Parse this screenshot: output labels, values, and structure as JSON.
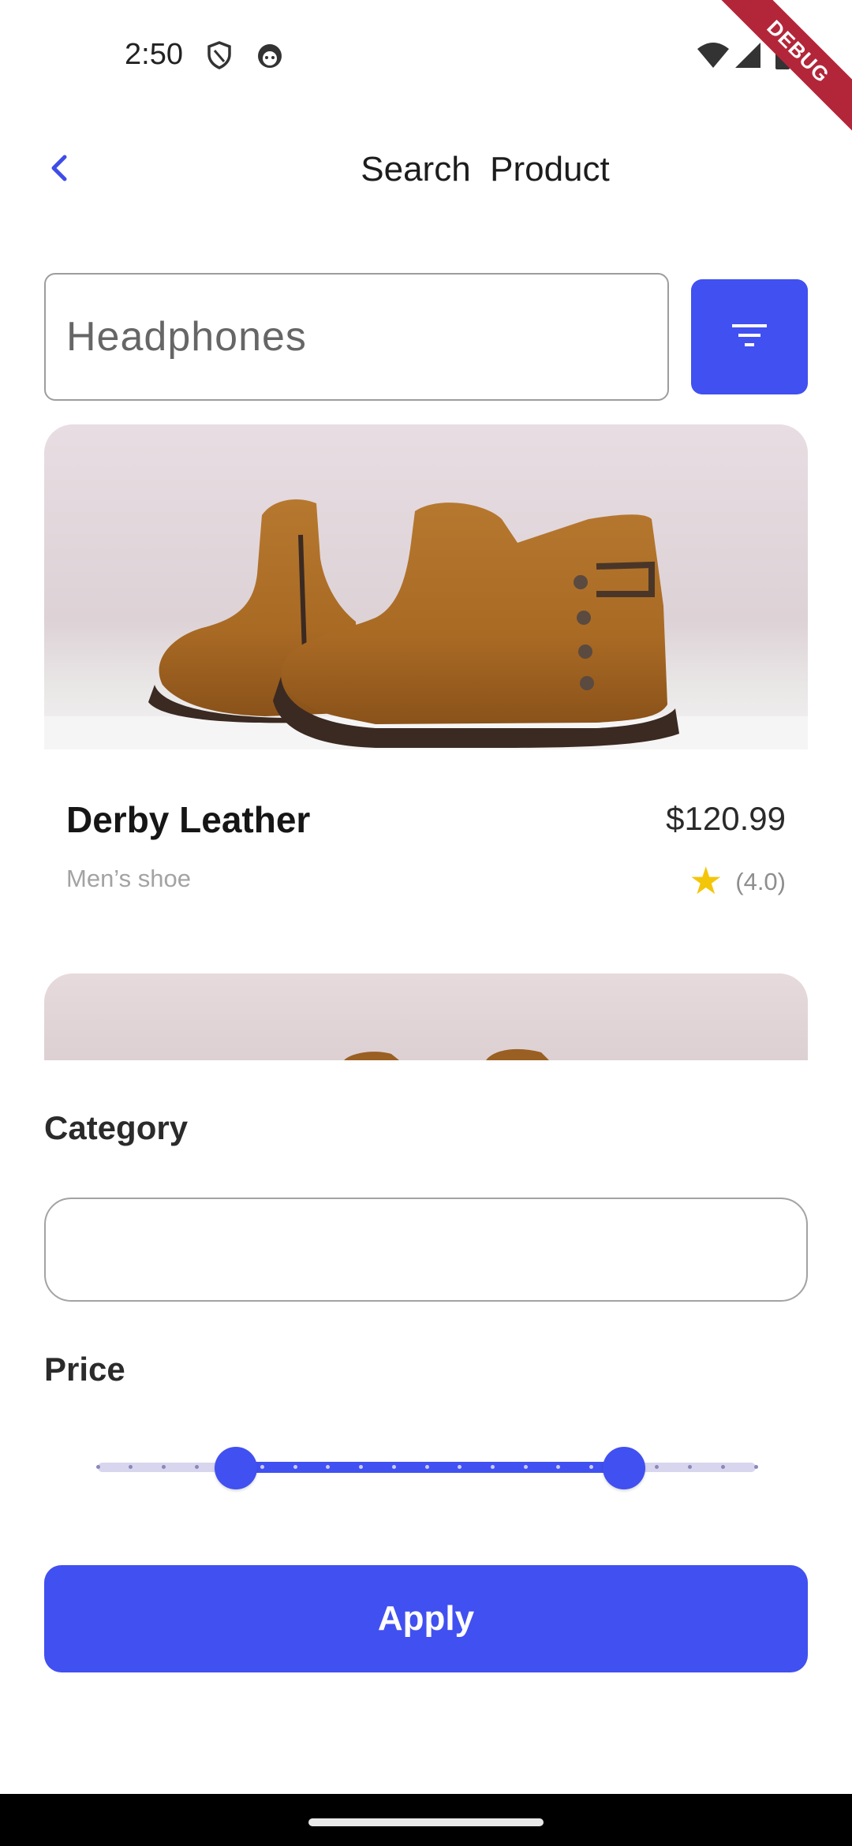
{
  "status_bar": {
    "time": "2:50",
    "icons": [
      "shield-icon",
      "face-icon",
      "wifi-icon",
      "signal-icon",
      "battery-icon"
    ],
    "debug_label": "DEBUG"
  },
  "header": {
    "title": "Search  Product",
    "back_icon": "chevron-left-icon"
  },
  "search": {
    "value": "",
    "placeholder": "Headphones",
    "filter_icon": "filter-icon"
  },
  "products": [
    {
      "name": "Derby Leather",
      "subtitle": "Men’s shoe",
      "price": "$120.99",
      "rating": "(4.0)",
      "rating_value": 4.0
    }
  ],
  "filter_sheet": {
    "category_label": "Category",
    "category_value": "",
    "price_label": "Price",
    "price_range": {
      "start_fraction": 0.21,
      "end_fraction": 0.8,
      "divisions": 20
    },
    "apply_label": "Apply"
  },
  "colors": {
    "accent": "#4150f0",
    "star": "#f4c60a",
    "debug_ribbon": "#b3263a",
    "slider_inactive": "#d8d6ee"
  }
}
